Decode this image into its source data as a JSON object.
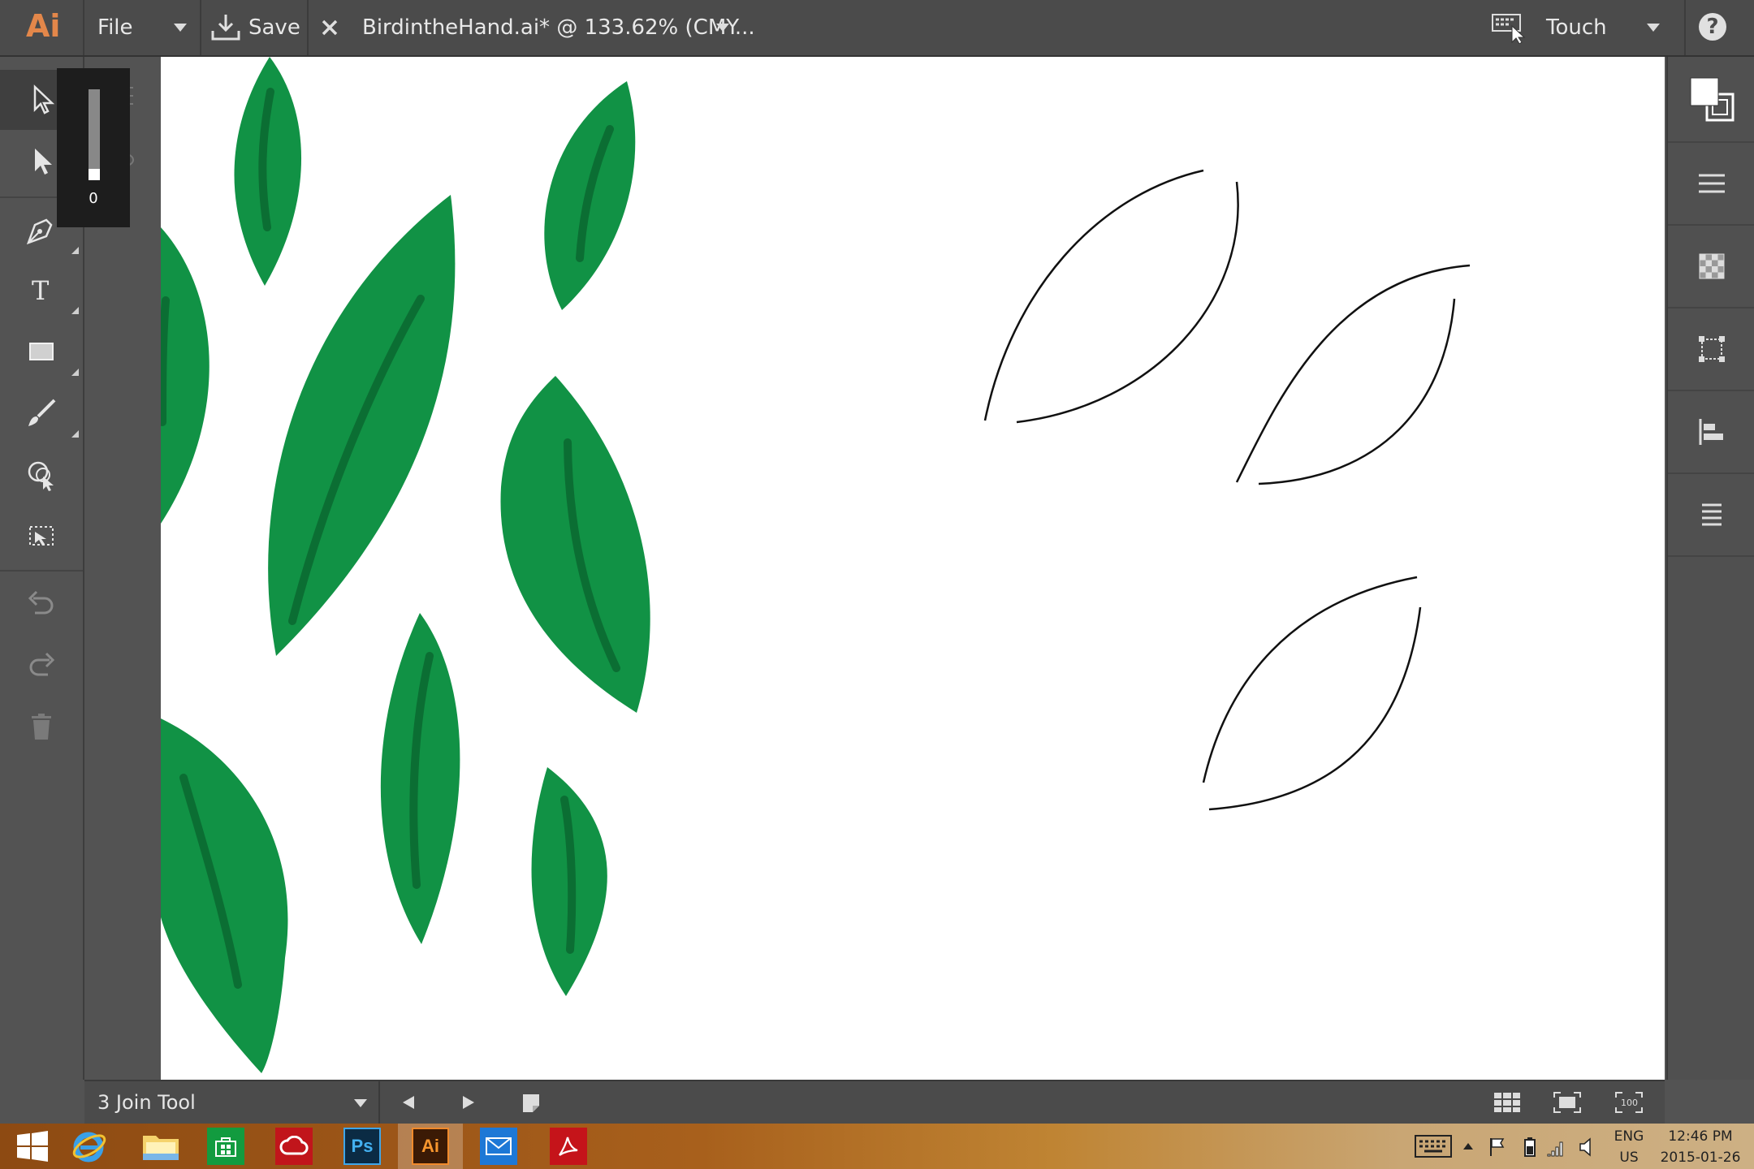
{
  "app": {
    "logo": "Ai"
  },
  "topbar": {
    "file_label": "File",
    "save_label": "Save",
    "doc_title": "BirdintheHand.ai* @ 133.62% (CMY...",
    "workspace_label": "Touch"
  },
  "brush_size_popup": {
    "value": "0"
  },
  "bottombar": {
    "status": "3 Join Tool"
  },
  "taskbar": {
    "lang": "ENG",
    "region": "US",
    "time": "12:46 PM",
    "date": "2015-01-26"
  },
  "colors": {
    "leaf_fill": "#119245",
    "leaf_vein": "#0b6e33",
    "canvas": "#ffffff",
    "ui_dark": "#4b4b4b"
  },
  "icons": {
    "selection": "selection-arrow-icon",
    "direct_selection": "direct-selection-icon",
    "pen": "pen-icon",
    "type": "type-icon",
    "rectangle": "rectangle-icon",
    "brush": "paintbrush-icon",
    "shaper": "shape-builder-icon",
    "crop": "crop-icon",
    "undo": "undo-icon",
    "redo": "redo-icon",
    "delete": "trash-icon"
  }
}
